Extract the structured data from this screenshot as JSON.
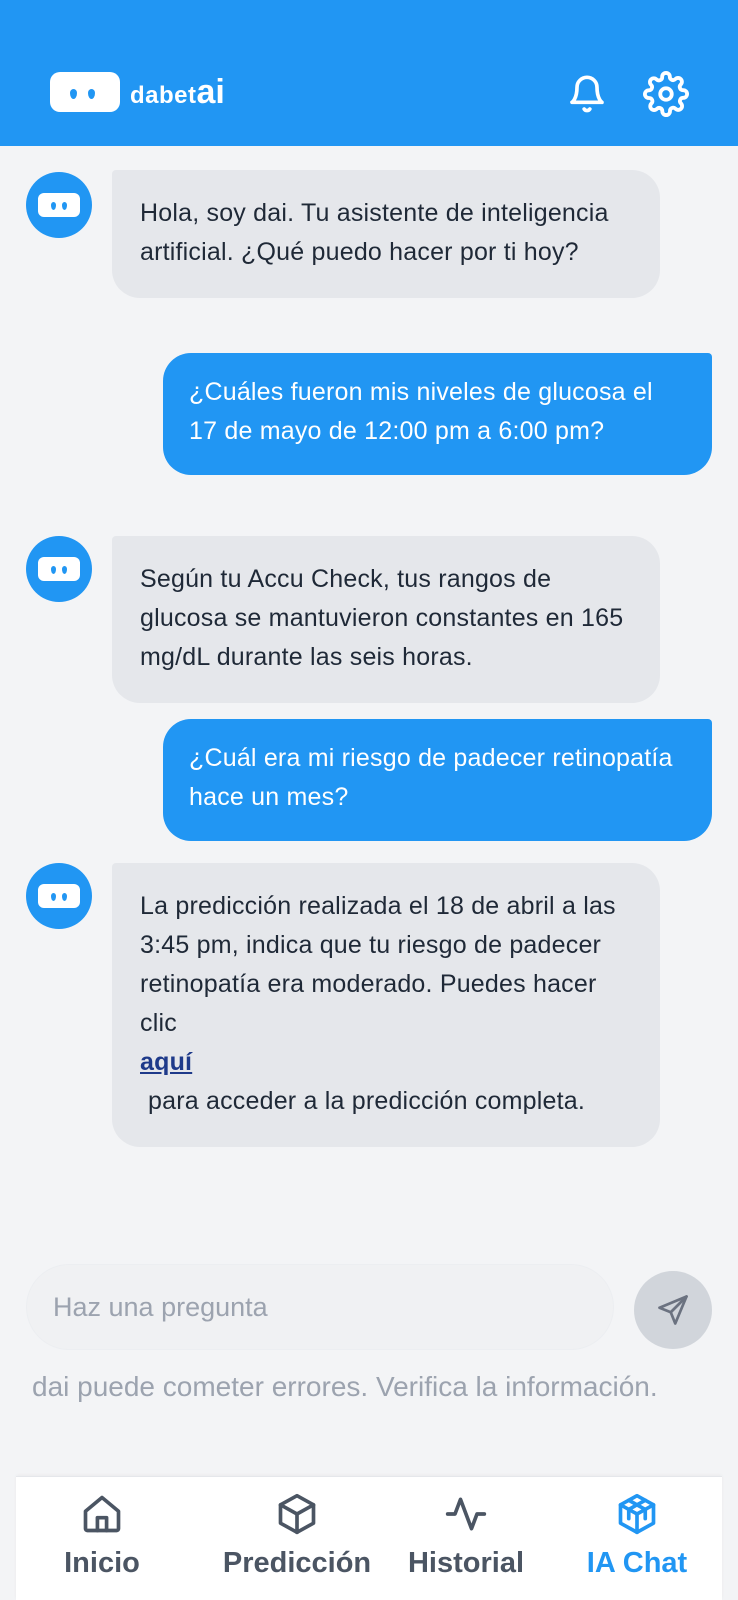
{
  "app": {
    "brand_prefix": "dabet",
    "brand_suffix": "ai"
  },
  "header": {
    "notifications_icon": "bell-icon",
    "settings_icon": "gear-icon",
    "background_color": "#2196f3"
  },
  "chat": {
    "messages": [
      {
        "role": "bot",
        "text": "Hola, soy dai. Tu asistente de inteligencia artificial. ¿Qué puedo hacer por ti hoy?"
      },
      {
        "role": "user",
        "text": "¿Cuáles fueron mis niveles de glucosa el 17 de mayo de 12:00 pm a 6:00 pm?"
      },
      {
        "role": "bot",
        "text": "Según tu Accu Check, tus rangos de glucosa se mantuvieron constantes en 165 mg/dL durante las seis horas."
      },
      {
        "role": "user",
        "text": "¿Cuál era mi riesgo de padecer retinopatía hace un mes?"
      },
      {
        "role": "bot",
        "text_before": "La predicción realizada el 18 de abril a las 3:45 pm, indica que tu riesgo de padecer retinopatía era moderado. Puedes hacer clic",
        "link_text": "aquí",
        "text_after": "para acceder a la predicción completa."
      }
    ]
  },
  "composer": {
    "placeholder": "Haz una pregunta",
    "value": "",
    "send_icon": "send-icon",
    "disclaimer": "dai puede cometer errores. Verifica la información."
  },
  "nav": {
    "items": [
      {
        "label": "Inicio",
        "icon": "home-icon",
        "active": false
      },
      {
        "label": "Predicción",
        "icon": "cube-icon",
        "active": false
      },
      {
        "label": "Historial",
        "icon": "activity-icon",
        "active": false
      },
      {
        "label": "IA Chat",
        "icon": "cubes-icon",
        "active": true
      }
    ],
    "active_color": "#2196f3",
    "inactive_color": "#4b5563"
  }
}
